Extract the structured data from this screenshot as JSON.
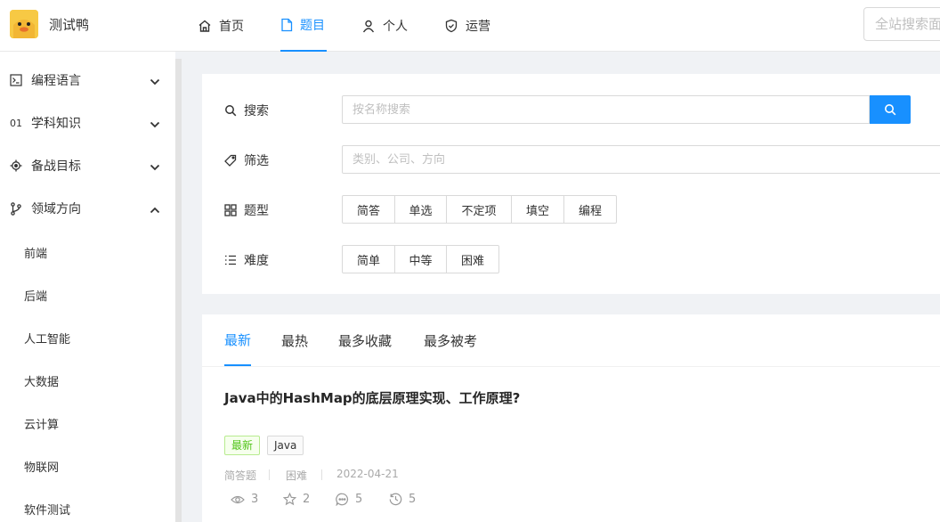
{
  "app": {
    "title": "测试鸭"
  },
  "nav": [
    {
      "label": "首页",
      "icon": "home-icon"
    },
    {
      "label": "题目",
      "icon": "file-icon",
      "active": true
    },
    {
      "label": "个人",
      "icon": "user-icon"
    },
    {
      "label": "运营",
      "icon": "shield-check-icon"
    }
  ],
  "global_search": {
    "placeholder": "全站搜索面试题"
  },
  "sidebar": {
    "items": [
      {
        "label": "编程语言",
        "icon": "terminal-icon",
        "expanded": false
      },
      {
        "label": "学科知识",
        "icon_text": "01",
        "expanded": false
      },
      {
        "label": "备战目标",
        "icon": "target-icon",
        "expanded": false
      },
      {
        "label": "领域方向",
        "icon": "branch-icon",
        "expanded": true
      }
    ],
    "subitems": [
      "前端",
      "后端",
      "人工智能",
      "大数据",
      "云计算",
      "物联网",
      "软件测试"
    ]
  },
  "filters": {
    "search": {
      "label": "搜索",
      "placeholder": "按名称搜索"
    },
    "filter": {
      "label": "筛选",
      "placeholder": "类别、公司、方向"
    },
    "type": {
      "label": "题型",
      "options": [
        "简答",
        "单选",
        "不定项",
        "填空",
        "编程"
      ]
    },
    "difficulty": {
      "label": "难度",
      "options": [
        "简单",
        "中等",
        "困难"
      ]
    }
  },
  "sort_tabs": [
    {
      "label": "最新",
      "active": true
    },
    {
      "label": "最热"
    },
    {
      "label": "最多收藏"
    },
    {
      "label": "最多被考"
    }
  ],
  "question": {
    "title": "Java中的HashMap的底层原理实现、工作原理?",
    "tags": [
      "最新",
      "Java"
    ],
    "type": "简答题",
    "difficulty": "困难",
    "date": "2022-04-21",
    "stats": {
      "views": "3",
      "stars": "2",
      "comments": "5",
      "history": "5"
    }
  },
  "colors": {
    "accent": "#1890ff",
    "new_tag": "#52c41a",
    "logo_bg": "#f7c944"
  }
}
